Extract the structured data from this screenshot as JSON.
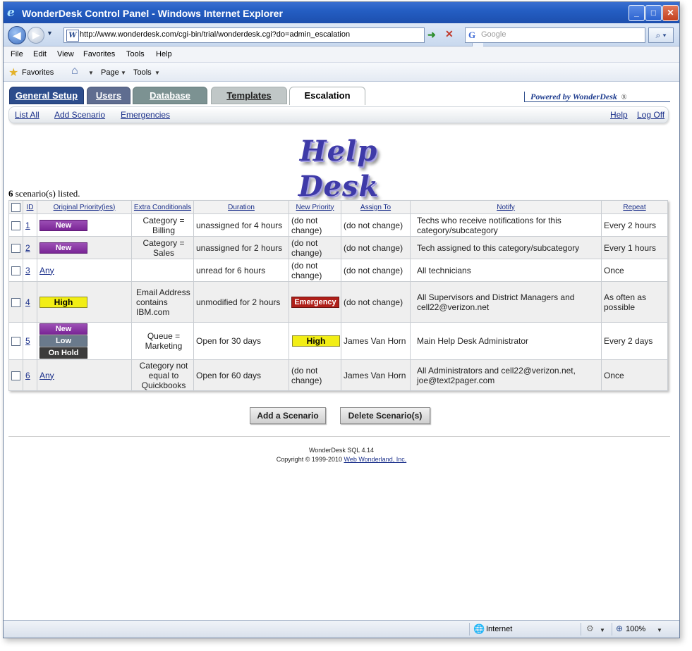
{
  "window": {
    "title": "WonderDesk Control Panel - Windows Internet Explorer",
    "min_glyph": "_",
    "max_glyph": "□",
    "close_glyph": "✕"
  },
  "address": {
    "url": "http://www.wonderdesk.com/cgi-bin/trial/wonderdesk.cgi?do=admin_escalation",
    "search_placeholder": "Google"
  },
  "menu": [
    "File",
    "Edit",
    "View",
    "Favorites",
    "Tools",
    "Help"
  ],
  "favbar": {
    "favorites": "Favorites",
    "page": "Page",
    "tools": "Tools"
  },
  "tabs": {
    "general_setup": "General Setup",
    "users": "Users",
    "database": "Database",
    "templates": "Templates",
    "escalation": "Escalation"
  },
  "powered_by": "Powered by WonderDesk",
  "powered_reg": "®",
  "subnav": {
    "list_all": "List All",
    "add_scenario": "Add Scenario",
    "emergencies": "Emergencies",
    "help": "Help",
    "log_off": "Log Off"
  },
  "logo_text": "Help Desk",
  "scenario_count": {
    "number": "6",
    "suffix": " scenario(s) listed."
  },
  "table": {
    "headers": {
      "id": "ID",
      "original_priority": "Original Priority(ies)",
      "extra_conditionals": "Extra Conditionals",
      "duration": "Duration",
      "new_priority": "New Priority",
      "assign_to": "Assign To",
      "notify": "Notify",
      "repeat": "Repeat"
    },
    "rows": [
      {
        "id": "1",
        "priorities": [
          "New"
        ],
        "condition": "Category = Billing",
        "duration": "unassigned for 4 hours",
        "new_priority": "(do not change)",
        "assign_to": "(do not change)",
        "notify": "Techs who receive notifications for this category/subcategory",
        "repeat": "Every 2 hours"
      },
      {
        "id": "2",
        "priorities": [
          "New"
        ],
        "condition": "Category = Sales",
        "duration": "unassigned for 2 hours",
        "new_priority": "(do not change)",
        "assign_to": "(do not change)",
        "notify": "Tech assigned to this category/subcategory",
        "repeat": "Every 1 hours"
      },
      {
        "id": "3",
        "priorities_any": "Any",
        "condition": "",
        "duration": "unread for 6 hours",
        "new_priority": "(do not change)",
        "assign_to": "(do not change)",
        "notify": "All technicians",
        "repeat": "Once"
      },
      {
        "id": "4",
        "priorities": [
          "High"
        ],
        "condition": "Email Address contains IBM.com",
        "duration": "unmodified for 2 hours",
        "new_priority_badge": "Emergency",
        "assign_to": "(do not change)",
        "notify": "All Supervisors and District Managers and cell22@verizon.net",
        "repeat": "As often as possible"
      },
      {
        "id": "5",
        "priorities": [
          "New",
          "Low",
          "On Hold"
        ],
        "condition": "Queue = Marketing",
        "duration": "Open for 30 days",
        "new_priority_badge": "High",
        "assign_to": "James Van Horn",
        "notify": "Main Help Desk Administrator",
        "repeat": "Every 2 days"
      },
      {
        "id": "6",
        "priorities_any": "Any",
        "condition": "Category not equal to Quickbooks",
        "duration": "Open for 60 days",
        "new_priority": "(do not change)",
        "assign_to": "James Van Horn",
        "notify": "All Administrators and cell22@verizon.net, joe@text2pager.com",
        "repeat": "Once"
      }
    ]
  },
  "buttons": {
    "add": "Add a Scenario",
    "delete": "Delete Scenario(s)"
  },
  "footer": {
    "version": "WonderDesk SQL 4.14",
    "copyright_prefix": "Copyright © 1999-2010 ",
    "company": "Web Wonderland, Inc."
  },
  "status": {
    "zone": "Internet",
    "zoom": "100%"
  },
  "colors": {
    "new": "#8a3aa6",
    "high": "#f2ee15",
    "low": "#6a7a8c",
    "on_hold": "#3c3c3c",
    "emergency": "#b0201a",
    "link": "#1a2f8a",
    "tab_active_blue": "#2d4d8c"
  }
}
